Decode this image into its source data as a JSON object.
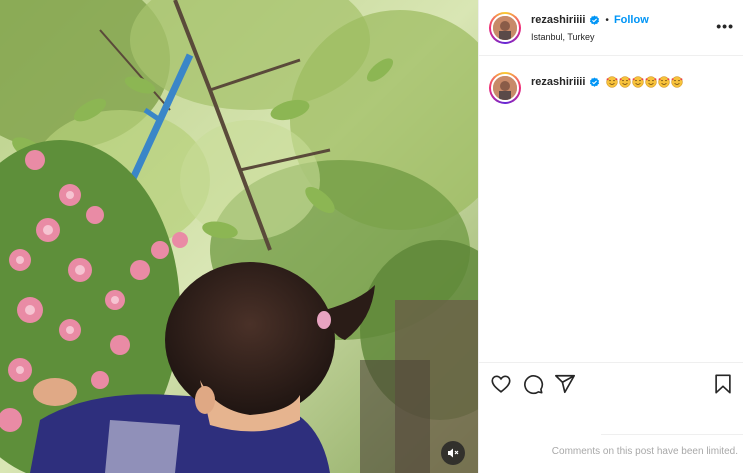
{
  "post": {
    "username": "rezashiriiii",
    "follow_label": "Follow",
    "separator": "•",
    "location": "Istanbul, Turkey",
    "more_label": "•••",
    "caption_username": "rezashiriiii",
    "caption_emoji_count": 6,
    "comments_limited_text": "Comments on this post have been limited."
  },
  "icons": {
    "verified": "verified-badge-icon",
    "emoji": "smiling-face-with-hearts-icon",
    "like": "heart-icon",
    "comment": "comment-bubble-icon",
    "share": "paper-plane-icon",
    "save": "bookmark-icon",
    "mute": "speaker-muted-icon"
  },
  "colors": {
    "accent": "#0095f6",
    "text": "#262626",
    "muted": "#a8a8a8",
    "border": "#efefef"
  }
}
